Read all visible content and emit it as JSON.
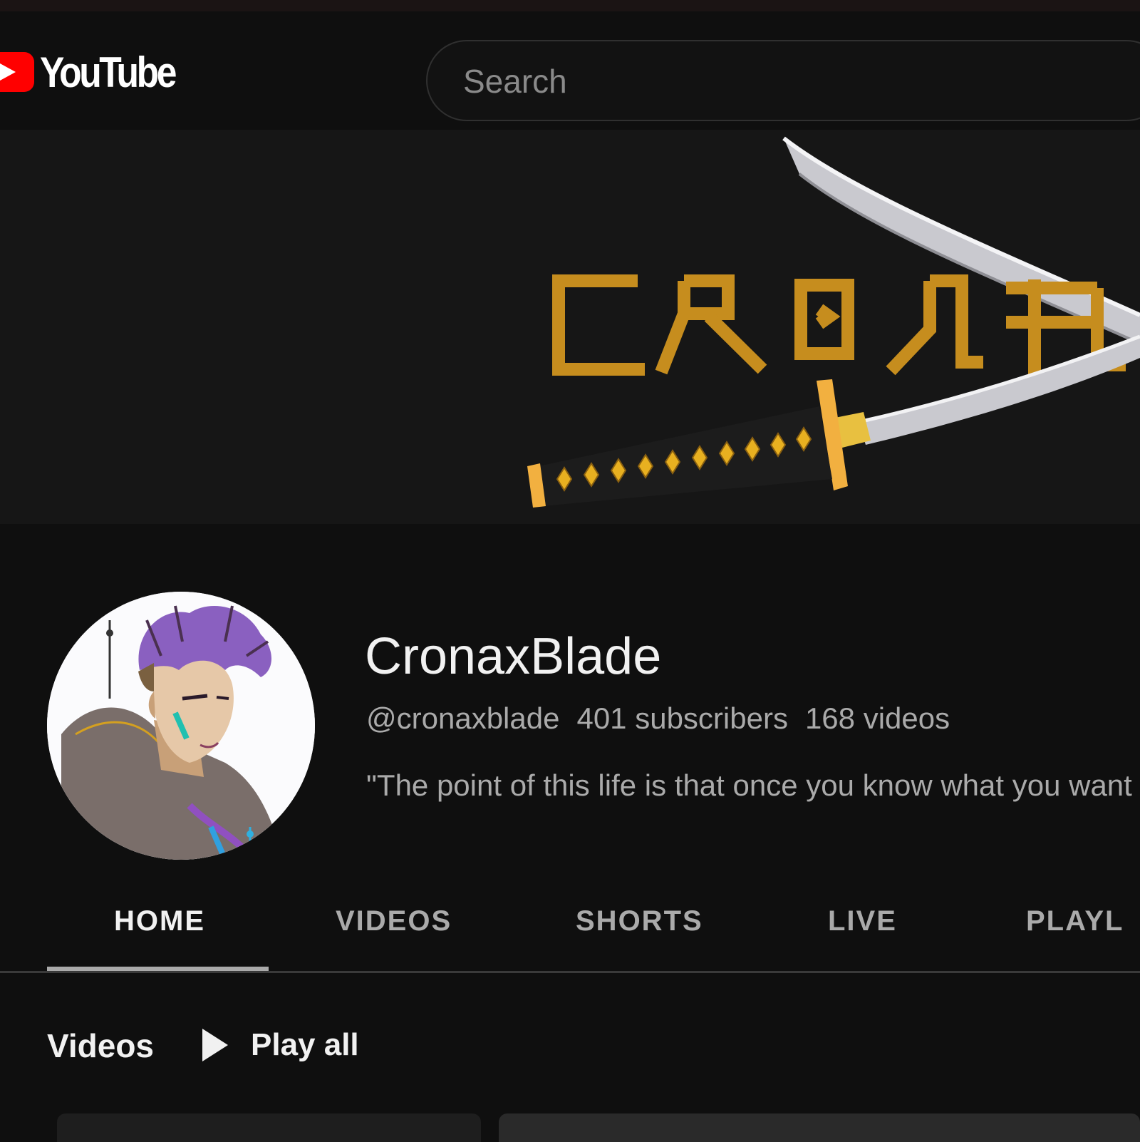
{
  "masthead": {
    "logo_text": "YouTube",
    "search_placeholder": "Search"
  },
  "banner": {
    "title_text": "CRONAX"
  },
  "channel": {
    "name": "CronaxBlade",
    "handle": "@cronaxblade",
    "subscribers": "401 subscribers",
    "videos": "168 videos",
    "description": "\"The point of this life is that once you know what you want"
  },
  "tabs": [
    {
      "label": "HOME",
      "active": true
    },
    {
      "label": "VIDEOS",
      "active": false
    },
    {
      "label": "SHORTS",
      "active": false
    },
    {
      "label": "LIVE",
      "active": false
    },
    {
      "label": "PLAYL",
      "active": false
    }
  ],
  "section": {
    "title": "Videos",
    "play_all": "Play all"
  },
  "colors": {
    "background": "#0f0f0f",
    "youtube_red": "#ff0000",
    "banner_gold": "#c68d1e",
    "muted_text": "#aaaaaa"
  }
}
